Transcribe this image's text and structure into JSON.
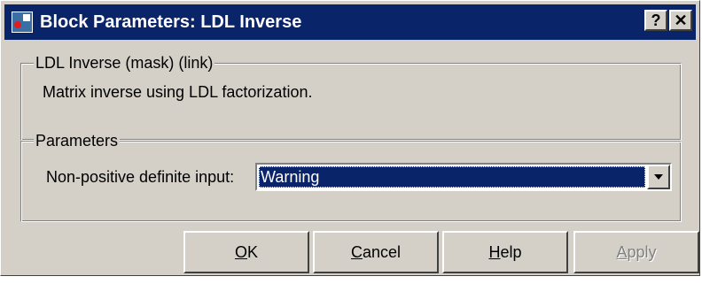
{
  "window": {
    "title": "Block Parameters: LDL Inverse",
    "icon": "simulink-block-icon",
    "help_button": "?",
    "close_button": "✕"
  },
  "mask_group": {
    "legend": "LDL Inverse (mask) (link)",
    "description": "Matrix inverse using LDL factorization."
  },
  "parameters_group": {
    "legend": "Parameters",
    "non_positive_label": "Non-positive definite input:",
    "non_positive_value": "Warning"
  },
  "buttons": {
    "ok": {
      "mnemonic": "O",
      "rest": "K"
    },
    "cancel": {
      "mnemonic": "C",
      "rest": "ancel"
    },
    "help": {
      "mnemonic": "H",
      "rest": "elp"
    },
    "apply": {
      "mnemonic": "A",
      "rest": "pply",
      "enabled": false
    }
  },
  "colors": {
    "titlebar": "#0a246a",
    "dialog_face": "#d4d0c8",
    "selection": "#0a246a"
  }
}
